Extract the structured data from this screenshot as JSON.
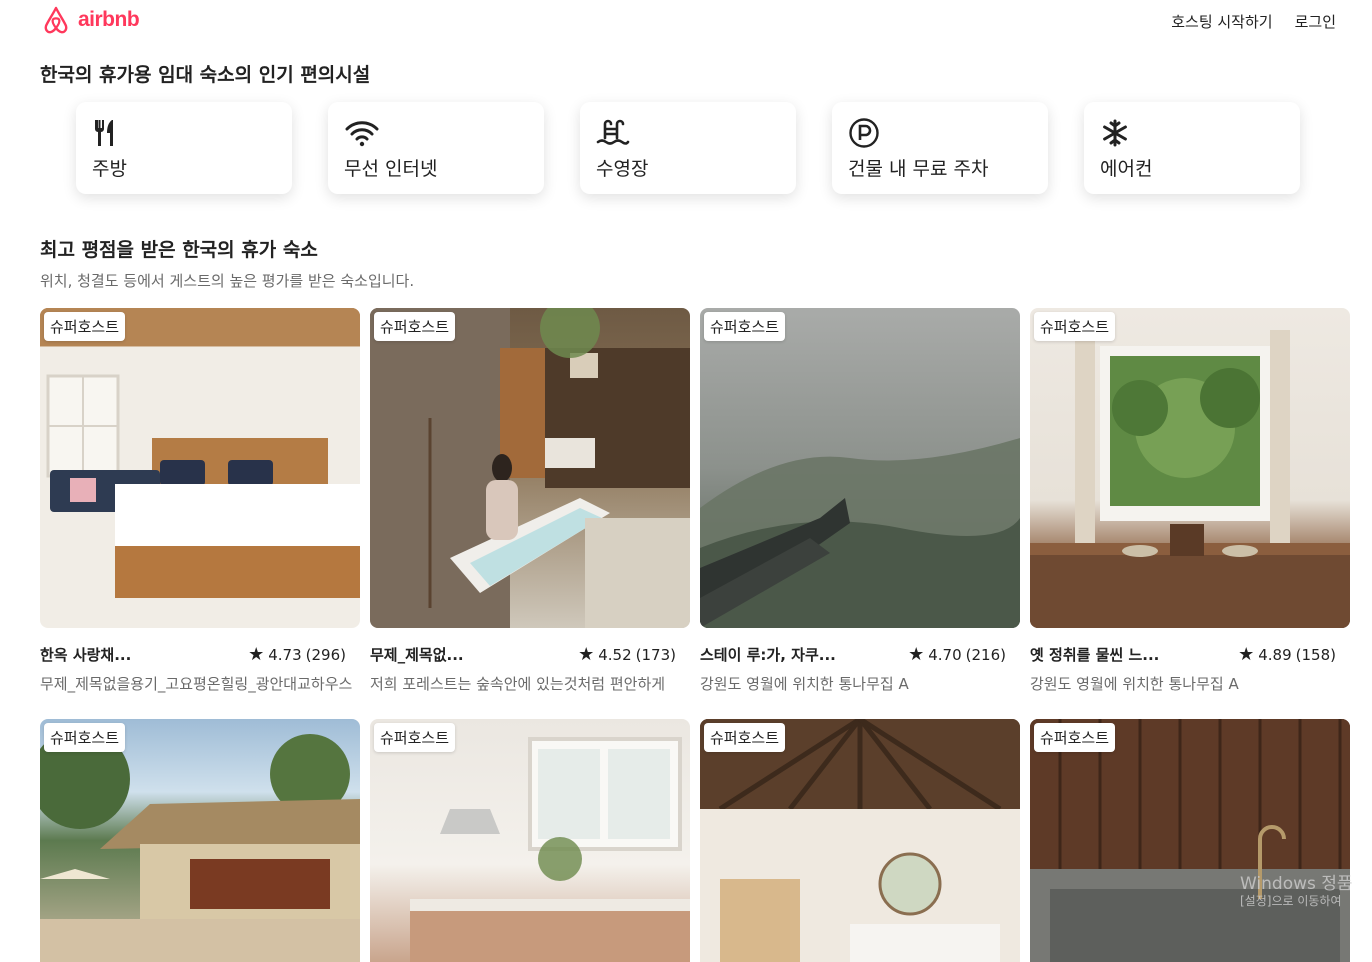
{
  "header": {
    "logo_text": "airbnb",
    "brand_color": "#FF385C",
    "nav": [
      "호스팅 시작하기",
      "로그인"
    ]
  },
  "amenities_section": {
    "title": "한국의 휴가용 임대 숙소의 인기 편의시설",
    "items": [
      {
        "icon": "utensils-icon",
        "label": "주방"
      },
      {
        "icon": "wifi-icon",
        "label": "무선 인터넷"
      },
      {
        "icon": "pool-icon",
        "label": "수영장"
      },
      {
        "icon": "parking-icon",
        "label": "건물 내 무료 주차"
      },
      {
        "icon": "snowflake-icon",
        "label": "에어컨"
      }
    ]
  },
  "listings_section": {
    "title": "최고 평점을 받은 한국의 휴가 숙소",
    "subtitle": "위치, 청결도 등에서 게스트의 높은 평가를 받은 숙소입니다.",
    "star_glyph": "★",
    "listings": [
      {
        "badge": "슈퍼호스트",
        "title": "한옥 사랑채...",
        "rating": "4.73",
        "reviews": "(296)",
        "description": "무제_제목없을용기_고요평온힐링_광안대교하우스"
      },
      {
        "badge": "슈퍼호스트",
        "title": "무제_제목없...",
        "rating": "4.52",
        "reviews": "(173)",
        "description": "저희 포레스트는 숲속안에 있는것처럼 편안하게"
      },
      {
        "badge": "슈퍼호스트",
        "title": "스테이 루:가, 자쿠...",
        "rating": "4.70",
        "reviews": "(216)",
        "description": "강원도 영월에 위치한 통나무집 A"
      },
      {
        "badge": "슈퍼호스트",
        "title": "옛 정취를 물씬 느...",
        "rating": "4.89",
        "reviews": "(158)",
        "description": "강원도 영월에 위치한 통나무집 A"
      },
      {
        "badge": "슈퍼호스트"
      },
      {
        "badge": "슈퍼호스트"
      },
      {
        "badge": "슈퍼호스트"
      },
      {
        "badge": "슈퍼호스트"
      }
    ]
  },
  "watermark": {
    "line1": "Windows 정품",
    "line2": "[설정]으로 이동하여"
  }
}
